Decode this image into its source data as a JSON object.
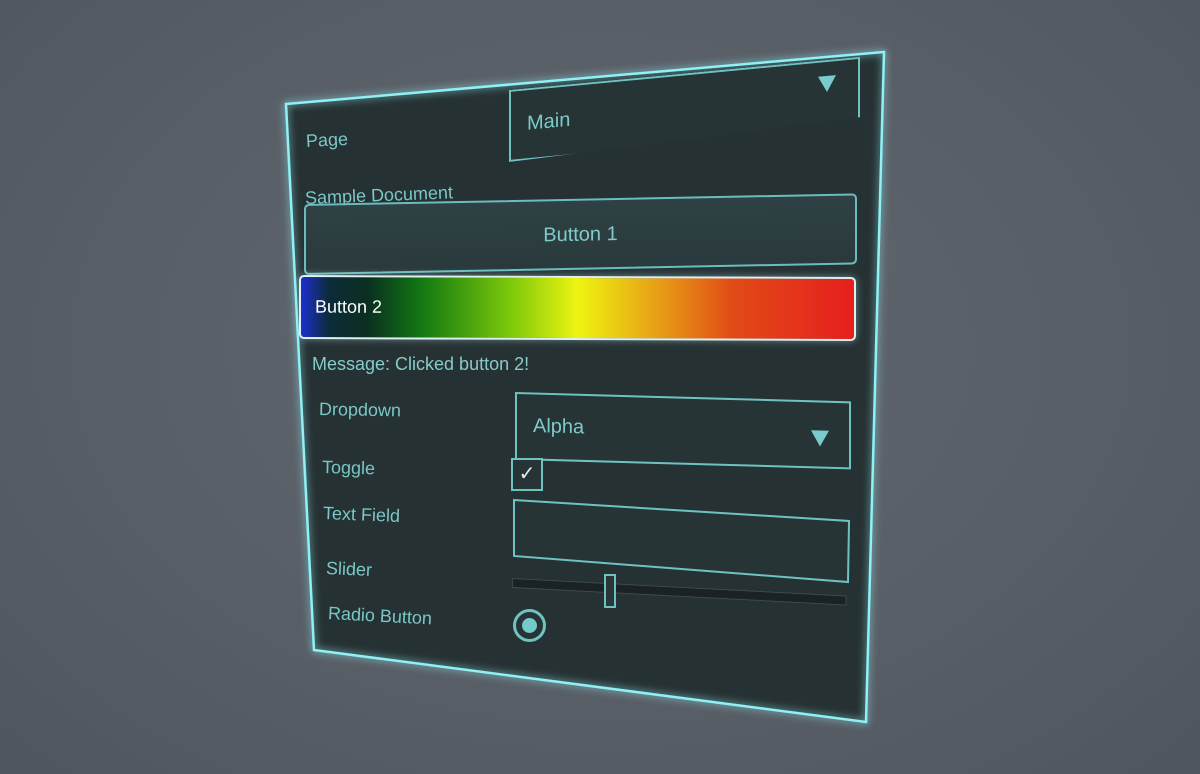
{
  "page_selector": {
    "label": "Page",
    "value": "Main"
  },
  "document": {
    "title": "Sample Document"
  },
  "buttons": {
    "button1_label": "Button 1",
    "button2_label": "Button 2"
  },
  "message": {
    "text": "Message: Clicked button 2!"
  },
  "dropdown": {
    "label": "Dropdown",
    "value": "Alpha"
  },
  "toggle": {
    "label": "Toggle",
    "checked": true,
    "check_glyph": "✓"
  },
  "text_field": {
    "label": "Text Field",
    "value": ""
  },
  "slider": {
    "label": "Slider",
    "value": 0.3
  },
  "radio": {
    "label": "Radio Button",
    "selected": true
  },
  "colors": {
    "accent": "#6fc2c2",
    "panel_bg": "#263133",
    "scene_bg": "#5a6068",
    "border_glow": "#8ff0f5"
  }
}
